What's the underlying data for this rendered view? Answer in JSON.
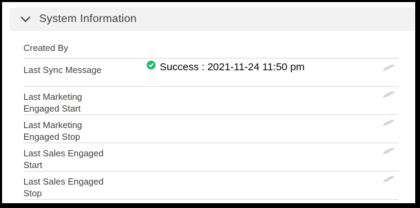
{
  "section": {
    "title": "System Information",
    "icon": "chevron-down-icon"
  },
  "fields": [
    {
      "label": "Created By",
      "value": ""
    },
    {
      "label": "Last Sync Message",
      "value": "Success : 2021-11-24 11:50 pm",
      "status_icon": "success-check-icon",
      "status_color": "#2bb673"
    },
    {
      "label_line1": "Last Marketing",
      "label_line2": "Engaged Start",
      "value": ""
    },
    {
      "label_line1": "Last Marketing",
      "label_line2": "Engaged Stop",
      "value": ""
    },
    {
      "label_line1": "Last Sales Engaged",
      "label_line2": "Start",
      "value": ""
    },
    {
      "label_line1": "Last Sales Engaged",
      "label_line2": "Stop",
      "value": ""
    }
  ],
  "colors": {
    "header_bg": "#f3f2f2",
    "divider": "#dddbda",
    "label_text": "#3e3e3c",
    "success": "#2bb673",
    "edit_icon": "#c9c7c5"
  }
}
